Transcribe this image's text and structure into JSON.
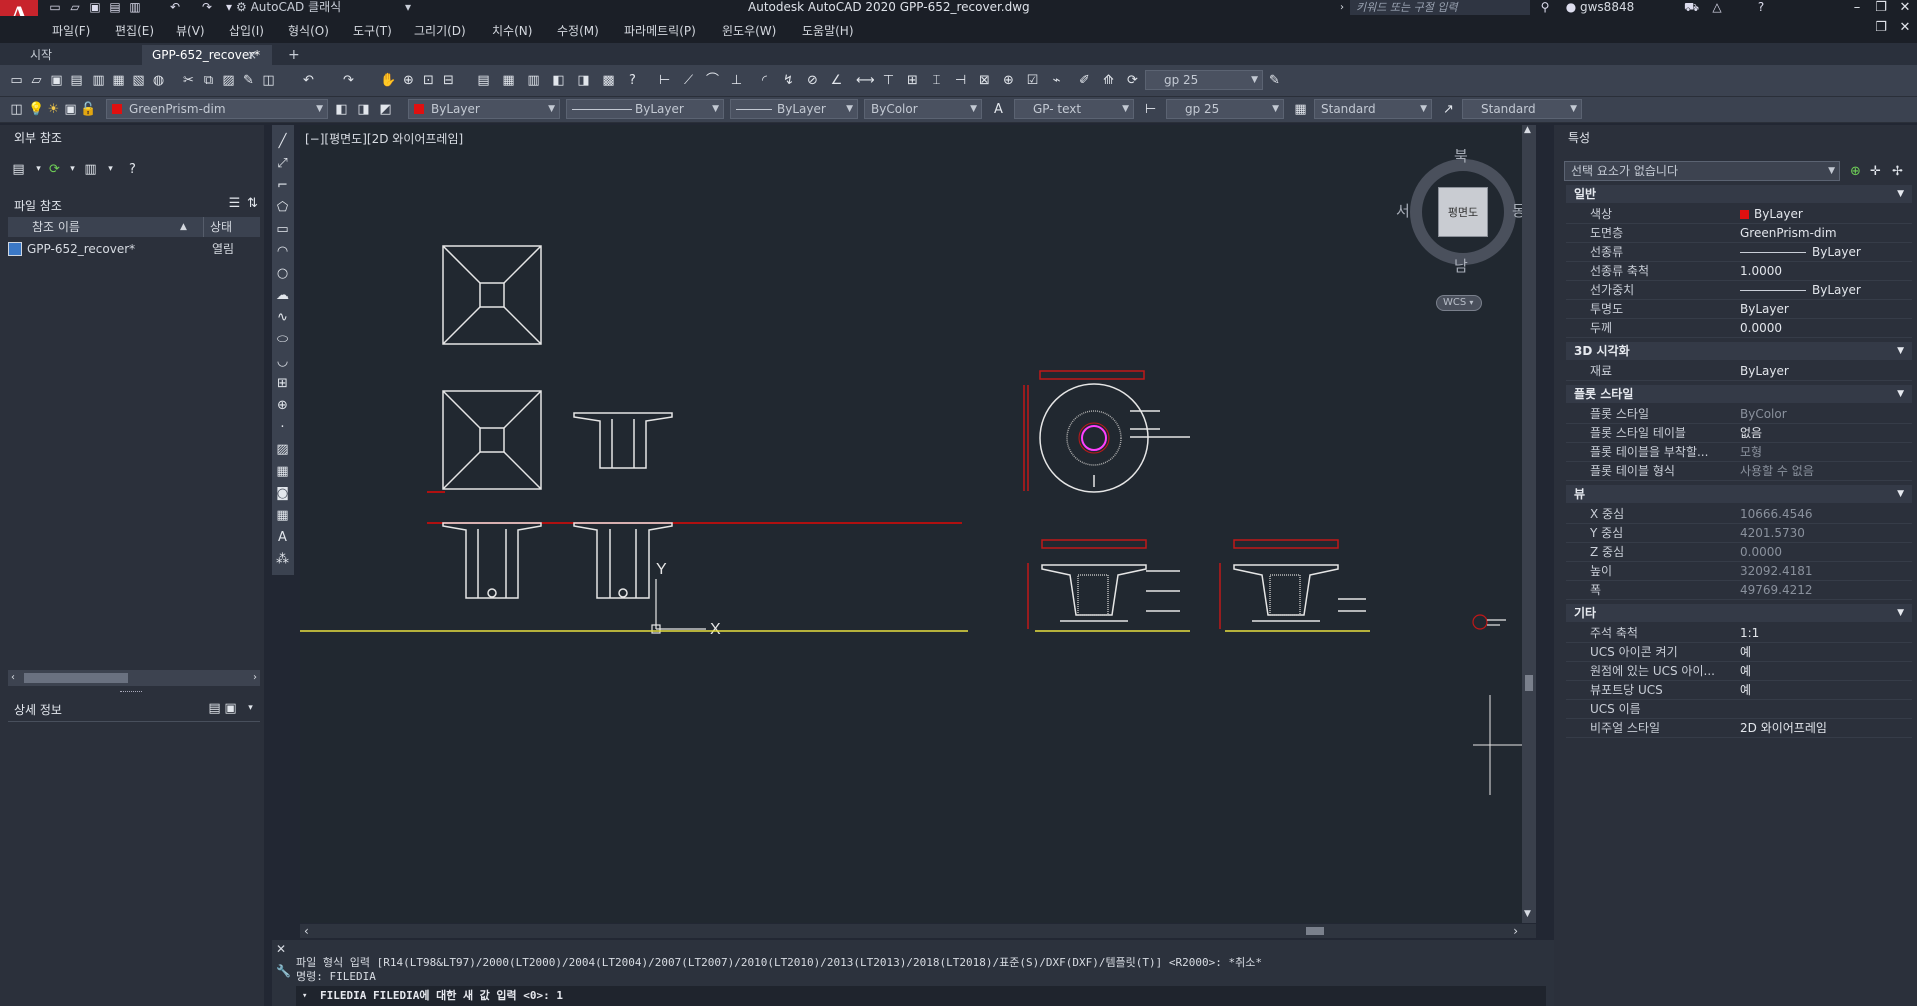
{
  "app": {
    "title": "Autodesk AutoCAD 2020    GPP-652_recover.dwg",
    "logo_letter": "A",
    "workspace": "AutoCAD 클래식",
    "search_placeholder": "키워드 또는 구절 입력",
    "user": "gws8848"
  },
  "menu": [
    "파일(F)",
    "편집(E)",
    "뷰(V)",
    "삽입(I)",
    "형식(O)",
    "도구(T)",
    "그리기(D)",
    "치수(N)",
    "수정(M)",
    "파라메트릭(P)",
    "윈도우(W)",
    "도움말(H)"
  ],
  "tabs": {
    "start": "시작",
    "active": "GPP-652_recover*",
    "close": "×",
    "add": "+"
  },
  "toolbar": {
    "dimstyle_combo": "gp 25",
    "layer_combo": "GreenPrism-dim",
    "color_combo": "ByLayer",
    "linetype_combo": "ByLayer",
    "lineweight_combo": "ByLayer",
    "plotstyle_combo": "ByColor",
    "textstyle_combo": "GP- text",
    "dimstyle2_combo": "gp 25",
    "tablestyle_combo": "Standard",
    "mleaderstyle_combo": "Standard"
  },
  "xref_panel": {
    "title": "외부 참조",
    "file_refs_title": "파일 참조",
    "col_name": "참조 이름",
    "col_status": "상태",
    "rows": [
      {
        "name": "GPP-652_recover*",
        "status": "열림"
      }
    ],
    "details_title": "상세 정보"
  },
  "canvas": {
    "viewport_label": "[−][평면도][2D 와이어프레임]",
    "viewcube": {
      "north": "북",
      "south": "남",
      "east": "동",
      "west": "서",
      "top": "평면도",
      "wcs": "WCS"
    },
    "ucs_x": "X",
    "ucs_y": "Y"
  },
  "properties": {
    "title": "특성",
    "selection": "선택 요소가 없습니다",
    "sections": [
      {
        "title": "일반",
        "rows": [
          {
            "name": "색상",
            "value": "ByLayer"
          },
          {
            "name": "도면층",
            "value": "GreenPrism-dim"
          },
          {
            "name": "선종류",
            "value": "ByLayer"
          },
          {
            "name": "선종류 축척",
            "value": "1.0000"
          },
          {
            "name": "선가중치",
            "value": "ByLayer"
          },
          {
            "name": "투명도",
            "value": "ByLayer"
          },
          {
            "name": "두께",
            "value": "0.0000"
          }
        ]
      },
      {
        "title": "3D 시각화",
        "rows": [
          {
            "name": "재료",
            "value": "ByLayer"
          }
        ]
      },
      {
        "title": "플롯 스타일",
        "rows": [
          {
            "name": "플롯 스타일",
            "value": "ByColor"
          },
          {
            "name": "플롯 스타일 테이블",
            "value": "없음"
          },
          {
            "name": "플롯 테이블을 부착할...",
            "value": "모형"
          },
          {
            "name": "플롯 테이블 형식",
            "value": "사용할 수 없음"
          }
        ]
      },
      {
        "title": "뷰",
        "rows": [
          {
            "name": "X 중심",
            "value": "10666.4546"
          },
          {
            "name": "Y 중심",
            "value": "4201.5730"
          },
          {
            "name": "Z 중심",
            "value": "0.0000"
          },
          {
            "name": "높이",
            "value": "32092.4181"
          },
          {
            "name": "폭",
            "value": "49769.4212"
          }
        ]
      },
      {
        "title": "기타",
        "rows": [
          {
            "name": "주석 축척",
            "value": "1:1"
          },
          {
            "name": "UCS 아이콘 켜기",
            "value": "예"
          },
          {
            "name": "원점에 있는 UCS 아이...",
            "value": "예"
          },
          {
            "name": "뷰포트당 UCS",
            "value": "예"
          },
          {
            "name": "UCS 이름",
            "value": ""
          },
          {
            "name": "비주얼 스타일",
            "value": "2D 와이어프레임"
          }
        ]
      }
    ]
  },
  "command": {
    "history1": "파일 형식 입력 [R14(LT98&LT97)/2000(LT2000)/2004(LT2004)/2007(LT2007)/2010(LT2010)/2013(LT2013)/2018(LT2018)/표준(S)/DXF(DXF)/템플릿(T)] <R2000>: *취소*",
    "history2": "명령: FILEDIA",
    "prompt": "FILEDIA FILEDIA에 대한 새 값 입력 <0>: 1"
  },
  "colors": {
    "red_swatch": "#e01010",
    "accent_red": "#c8242c"
  }
}
